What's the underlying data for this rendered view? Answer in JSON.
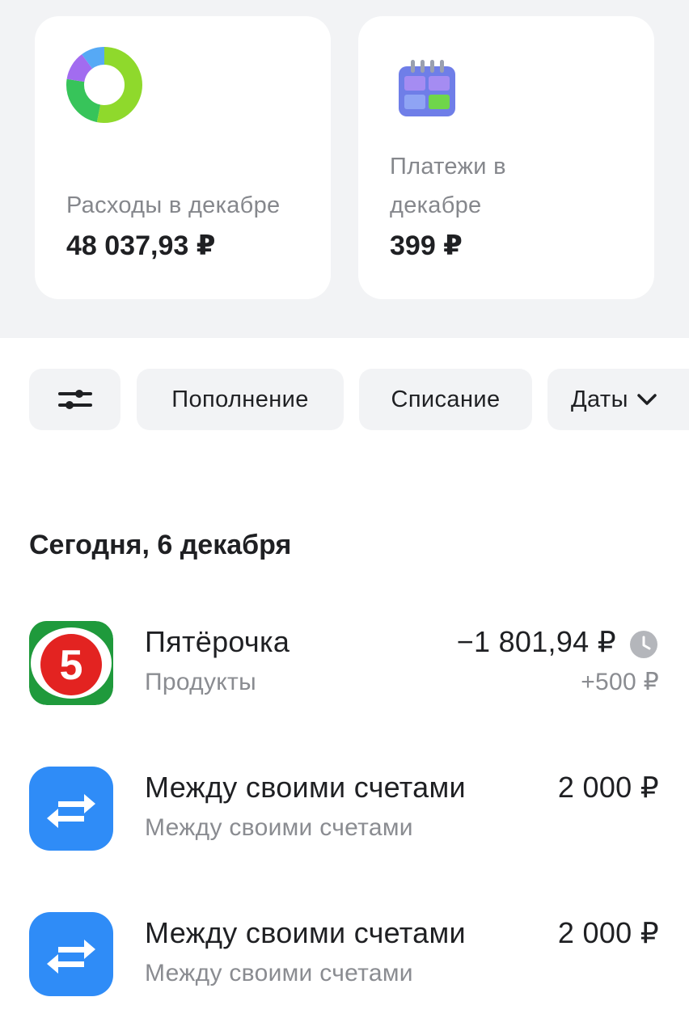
{
  "summary": {
    "expenses": {
      "label": "Расходы в декабре",
      "value": "48 037,93 ₽",
      "icon": "donut-chart-icon"
    },
    "payments": {
      "label": "Платежи в декабре",
      "value": "399 ₽",
      "icon": "calendar-icon"
    }
  },
  "filters": {
    "filter_icon": "sliders-icon",
    "topup_label": "Пополнение",
    "debit_label": "Списание",
    "dates_label": "Даты"
  },
  "section": {
    "title": "Сегодня, 6 декабря"
  },
  "transactions": [
    {
      "name": "Пятёрочка",
      "category": "Продукты",
      "amount": "−1 801,94 ₽",
      "bonus": "+500 ₽",
      "icon": "pyaterochka-logo",
      "pending": true
    },
    {
      "name": "Между своими счетами",
      "category": "Между своими счетами",
      "amount": "2 000 ₽",
      "icon": "transfer-arrows-icon"
    },
    {
      "name": "Между своими счетами",
      "category": "Между своими счетами",
      "amount": "2 000 ₽",
      "icon": "transfer-arrows-icon"
    }
  ],
  "colors": {
    "background_top": "#f2f3f5",
    "transfer_blue": "#2f8cf7",
    "pyaterochka_red": "#e32321",
    "pyaterochka_green": "#1f9a3c"
  }
}
